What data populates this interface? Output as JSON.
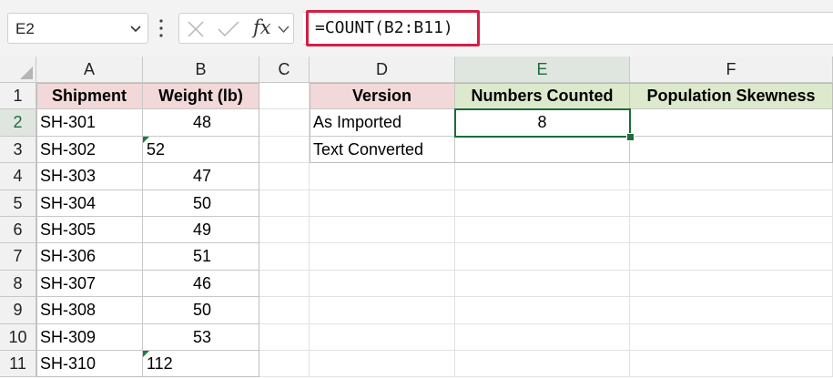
{
  "name_box": {
    "value": "E2"
  },
  "formula_bar": {
    "fx_label": "fx",
    "formula": "=COUNT(B2:B11)"
  },
  "columns": [
    "A",
    "B",
    "C",
    "D",
    "E",
    "F"
  ],
  "rows": [
    "1",
    "2",
    "3",
    "4",
    "5",
    "6",
    "7",
    "8",
    "9",
    "10",
    "11"
  ],
  "table1": {
    "headers": [
      "Shipment",
      "Weight (lb)"
    ],
    "rows": [
      {
        "id": "SH-301",
        "weight": "48"
      },
      {
        "id": "SH-302",
        "weight": "52"
      },
      {
        "id": "SH-303",
        "weight": "47"
      },
      {
        "id": "SH-304",
        "weight": "50"
      },
      {
        "id": "SH-305",
        "weight": "49"
      },
      {
        "id": "SH-306",
        "weight": "51"
      },
      {
        "id": "SH-307",
        "weight": "46"
      },
      {
        "id": "SH-308",
        "weight": "50"
      },
      {
        "id": "SH-309",
        "weight": "53"
      },
      {
        "id": "SH-310",
        "weight": "112"
      }
    ]
  },
  "table2": {
    "headers": [
      "Version",
      "Numbers Counted",
      "Population Skewness"
    ],
    "rows": [
      {
        "version": "As Imported",
        "count": "8",
        "skew": ""
      },
      {
        "version": "Text Converted",
        "count": "",
        "skew": ""
      }
    ]
  },
  "colors": {
    "accent": "#1e6b3a",
    "formula_highlight": "#d41f45",
    "pink_header": "#f2d8d8",
    "green_header": "#dde9cc"
  },
  "icons": [
    "chevron-down-icon",
    "more-vertical-icon",
    "cancel-x-icon",
    "check-icon",
    "fx-icon",
    "select-all-icon",
    "error-indicator-icon"
  ]
}
